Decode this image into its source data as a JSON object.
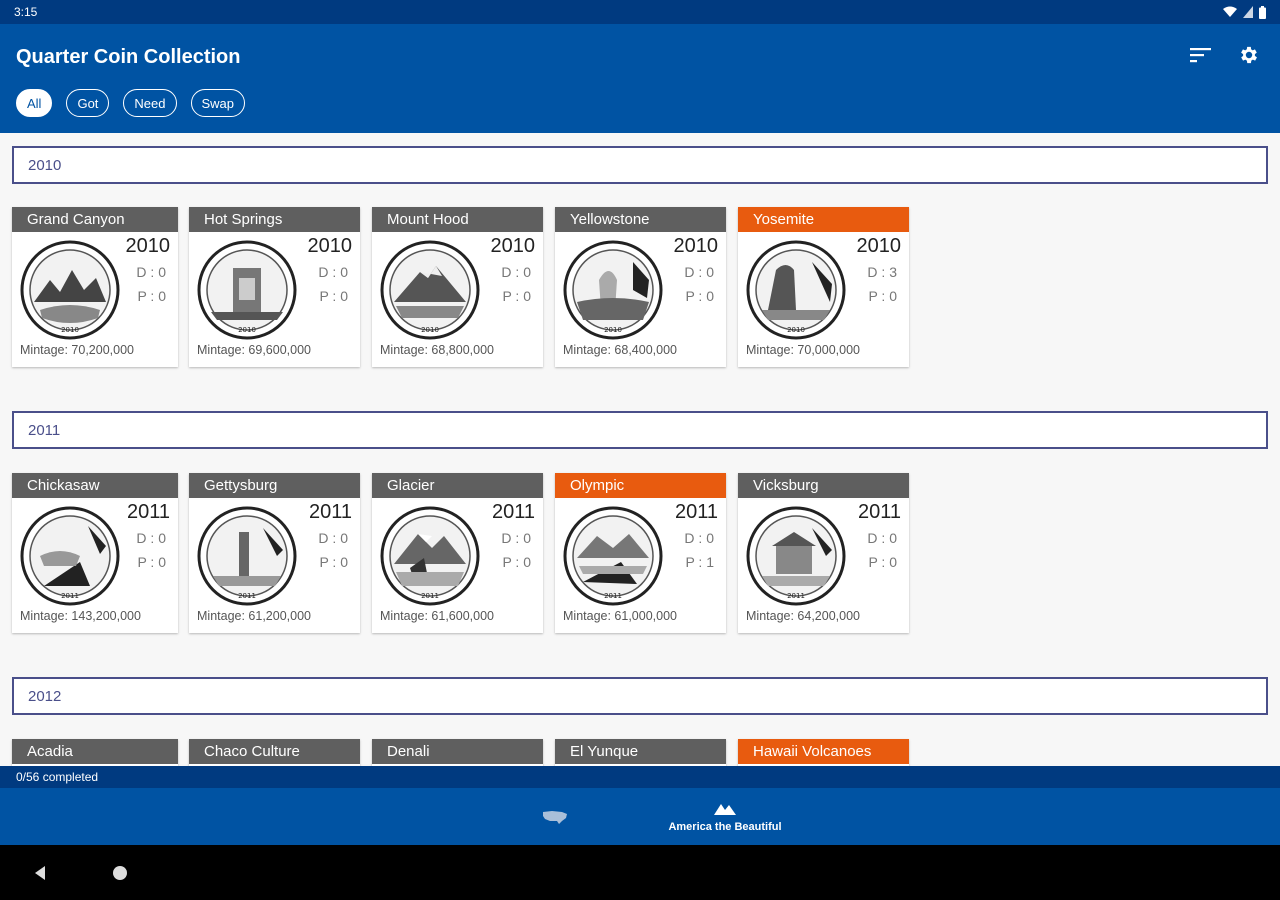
{
  "status": {
    "time": "3:15"
  },
  "app": {
    "title": "Quarter Coin Collection"
  },
  "filters": [
    {
      "label": "All",
      "active": true
    },
    {
      "label": "Got",
      "active": false
    },
    {
      "label": "Need",
      "active": false
    },
    {
      "label": "Swap",
      "active": false
    }
  ],
  "sections": [
    {
      "year": "2010",
      "coins": [
        {
          "name": "Grand Canyon",
          "year": "2010",
          "d": "D : 0",
          "p": "P : 0",
          "mintage": "Mintage: 70,200,000",
          "need": false
        },
        {
          "name": "Hot Springs",
          "year": "2010",
          "d": "D : 0",
          "p": "P : 0",
          "mintage": "Mintage: 69,600,000",
          "need": false
        },
        {
          "name": "Mount Hood",
          "year": "2010",
          "d": "D : 0",
          "p": "P : 0",
          "mintage": "Mintage: 68,800,000",
          "need": false
        },
        {
          "name": "Yellowstone",
          "year": "2010",
          "d": "D : 0",
          "p": "P : 0",
          "mintage": "Mintage: 68,400,000",
          "need": false
        },
        {
          "name": "Yosemite",
          "year": "2010",
          "d": "D : 3",
          "p": "P : 0",
          "mintage": "Mintage: 70,000,000",
          "need": true
        }
      ]
    },
    {
      "year": "2011",
      "coins": [
        {
          "name": "Chickasaw",
          "year": "2011",
          "d": "D : 0",
          "p": "P : 0",
          "mintage": "Mintage: 143,200,000",
          "need": false
        },
        {
          "name": "Gettysburg",
          "year": "2011",
          "d": "D : 0",
          "p": "P : 0",
          "mintage": "Mintage: 61,200,000",
          "need": false
        },
        {
          "name": "Glacier",
          "year": "2011",
          "d": "D : 0",
          "p": "P : 0",
          "mintage": "Mintage: 61,600,000",
          "need": false
        },
        {
          "name": "Olympic",
          "year": "2011",
          "d": "D : 0",
          "p": "P : 1",
          "mintage": "Mintage: 61,000,000",
          "need": true
        },
        {
          "name": "Vicksburg",
          "year": "2011",
          "d": "D : 0",
          "p": "P : 0",
          "mintage": "Mintage: 64,200,000",
          "need": false
        }
      ]
    },
    {
      "year": "2012",
      "coins": [
        {
          "name": "Acadia",
          "need": false
        },
        {
          "name": "Chaco Culture",
          "need": false
        },
        {
          "name": "Denali",
          "need": false
        },
        {
          "name": "El Yunque",
          "need": false
        },
        {
          "name": "Hawaii Volcanoes",
          "need": true
        }
      ]
    }
  ],
  "progress": {
    "text": "0/56 completed"
  },
  "bottom_nav": {
    "active_label": "America the Beautiful"
  },
  "icons": {
    "sort": "sort-icon",
    "settings": "gear-icon",
    "map": "usa-map-icon",
    "mountain": "mountain-icon",
    "back": "back-icon",
    "home": "home-icon"
  },
  "colors": {
    "primary": "#0053a3",
    "dark": "#003a80",
    "need": "#e85b0f",
    "title_gray": "#5f5f5f",
    "header_border": "#4a4f8a"
  }
}
